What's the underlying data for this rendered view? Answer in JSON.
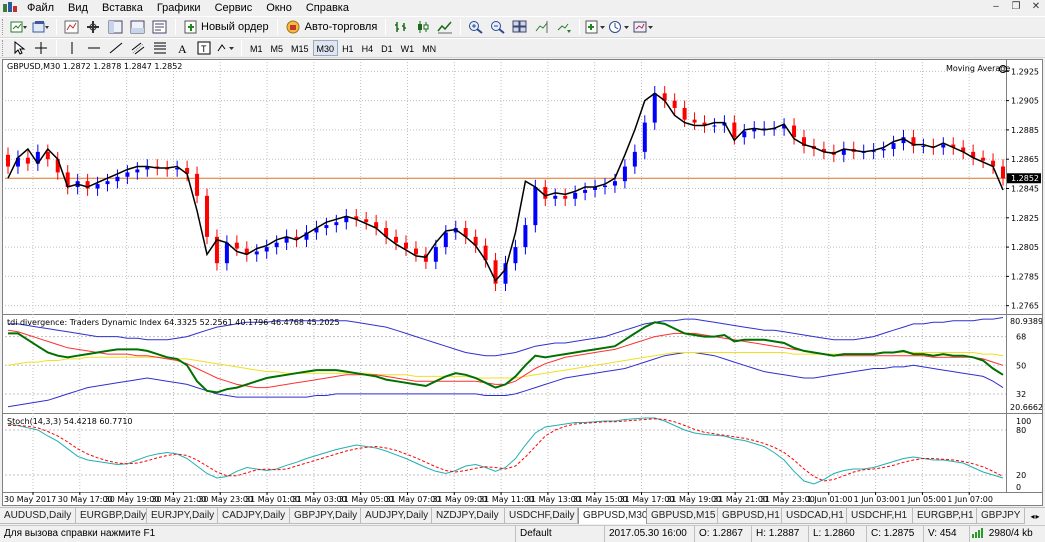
{
  "menu": {
    "items": [
      "Файл",
      "Вид",
      "Вставка",
      "Графики",
      "Сервис",
      "Окно",
      "Справка"
    ]
  },
  "window_controls": [
    "–",
    "❐",
    "✕"
  ],
  "toolbar": {
    "new_order_label": "Новый ордер",
    "autotrading_label": "Авто-торговля",
    "timeframes": [
      "M1",
      "M5",
      "M15",
      "M30",
      "H1",
      "H4",
      "D1",
      "W1",
      "MN"
    ],
    "active_timeframe": "M30"
  },
  "chart": {
    "symbol_header": "GBPUSD,M30  1.2872 1.2878 1.2847 1.2852",
    "indicator_label": "Moving Average",
    "price_ticks": [
      "1.2925",
      "1.2905",
      "1.2885",
      "1.2865",
      "1.2845",
      "1.2825",
      "1.2805",
      "1.2785",
      "1.2765"
    ],
    "price_tick_values": [
      1.2925,
      1.2905,
      1.2885,
      1.2865,
      1.2845,
      1.2825,
      1.2805,
      1.2785,
      1.2765
    ],
    "current_price": "1.2852",
    "current_price_value": 1.2852,
    "tdi_label": "tdi divergence: Traders Dynamic Index 64.3325 52.2561 40.1796 46.4768 45.2025",
    "tdi_ticks": [
      "80.9389",
      "68",
      "50",
      "32",
      "20.6662"
    ],
    "tdi_tick_values": [
      80.9389,
      68,
      50,
      32,
      20.6662
    ],
    "stoch_label": "Stoch(14,3,3) 54.4218 60.7710",
    "stoch_ticks": [
      "100",
      "80",
      "20",
      "0"
    ],
    "stoch_tick_values": [
      100,
      80,
      20,
      0
    ],
    "time_labels": [
      "30 May 2017",
      "30 May 17:00",
      "30 May 19:00",
      "30 May 21:00",
      "30 May 23:00",
      "31 May 01:00",
      "31 May 03:00",
      "31 May 05:00",
      "31 May 07:00",
      "31 May 09:00",
      "31 May 11:00",
      "31 May 13:00",
      "31 May 15:00",
      "31 May 17:00",
      "31 May 19:00",
      "31 May 21:00",
      "31 May 23:00",
      "1 Jun 01:00",
      "1 Jun 03:00",
      "1 Jun 05:00",
      "1 Jun 07:00"
    ],
    "colors": {
      "bull": "#0000ff",
      "bear": "#ff0000",
      "ma": "#000000",
      "price_line": "#e07020",
      "tdi_blue": "#3030d0",
      "tdi_green": "#007000",
      "tdi_red": "#ff3030",
      "tdi_yellow": "#f0e020",
      "stoch_main": "#20b0b0",
      "stoch_signal": "#ff0000",
      "grid": "#c0c0c0"
    }
  },
  "chart_data": {
    "type": "candlestick",
    "price_close": [
      1.286,
      1.2866,
      1.2862,
      1.287,
      1.2865,
      1.2856,
      1.2846,
      1.285,
      1.2845,
      1.2848,
      1.285,
      1.2853,
      1.2856,
      1.2858,
      1.286,
      1.2859,
      1.2858,
      1.2859,
      1.2855,
      1.284,
      1.2812,
      1.2794,
      1.2808,
      1.2804,
      1.28,
      1.2802,
      1.2805,
      1.2808,
      1.2812,
      1.281,
      1.2815,
      1.2818,
      1.282,
      1.2822,
      1.2826,
      1.2824,
      1.2822,
      1.2818,
      1.2812,
      1.2808,
      1.2804,
      1.28,
      1.2795,
      1.2805,
      1.2815,
      1.2818,
      1.2812,
      1.2806,
      1.2796,
      1.278,
      1.2794,
      1.2805,
      1.282,
      1.2846,
      1.2838,
      1.284,
      1.2838,
      1.2842,
      1.2844,
      1.2846,
      1.2847,
      1.285,
      1.286,
      1.287,
      1.289,
      1.291,
      1.2905,
      1.29,
      1.2892,
      1.289,
      1.2888,
      1.2888,
      1.289,
      1.288,
      1.2884,
      1.2886,
      1.2886,
      1.2886,
      1.2888,
      1.288,
      1.2874,
      1.2872,
      1.287,
      1.2868,
      1.2872,
      1.287,
      1.287,
      1.2871,
      1.2872,
      1.2876,
      1.288,
      1.2874,
      1.2874,
      1.2873,
      1.2875,
      1.2873,
      1.287,
      1.2866,
      1.2864,
      1.286,
      1.2852
    ],
    "ma_values": [
      1.2852,
      1.2866,
      1.2872,
      1.2862,
      1.2872,
      1.2865,
      1.2846,
      1.2848,
      1.2846,
      1.2849,
      1.2852,
      1.2855,
      1.2858,
      1.286,
      1.286,
      1.2859,
      1.2859,
      1.286,
      1.2855,
      1.283,
      1.28,
      1.281,
      1.2808,
      1.2802,
      1.28,
      1.2804,
      1.2806,
      1.281,
      1.2812,
      1.281,
      1.2814,
      1.2818,
      1.2822,
      1.2824,
      1.2826,
      1.2824,
      1.2821,
      1.2818,
      1.2812,
      1.2807,
      1.2803,
      1.2799,
      1.2798,
      1.2808,
      1.2816,
      1.2817,
      1.2812,
      1.2806,
      1.2796,
      1.2782,
      1.279,
      1.2815,
      1.285,
      1.2846,
      1.284,
      1.2842,
      1.2841,
      1.2843,
      1.2846,
      1.2846,
      1.2848,
      1.2852,
      1.2868,
      1.2885,
      1.2905,
      1.291,
      1.2905,
      1.2895,
      1.289,
      1.2888,
      1.2888,
      1.289,
      1.289,
      1.2878,
      1.2885,
      1.2886,
      1.2885,
      1.2886,
      1.2889,
      1.2879,
      1.2875,
      1.2873,
      1.287,
      1.2869,
      1.2872,
      1.2871,
      1.287,
      1.2871,
      1.2873,
      1.2877,
      1.2879,
      1.2875,
      1.2875,
      1.2873,
      1.2876,
      1.2873,
      1.287,
      1.2866,
      1.2863,
      1.286,
      1.2844
    ],
    "tdi_upper": [
      76,
      76,
      75,
      74,
      73,
      72,
      71,
      70,
      69,
      68,
      68,
      68,
      67,
      67,
      66,
      66,
      66,
      67,
      68,
      70,
      72,
      74,
      75,
      76,
      77,
      77,
      77,
      78,
      78,
      78,
      78,
      78,
      78,
      78,
      78,
      77,
      76,
      75,
      74,
      72,
      70,
      68,
      66,
      64,
      62,
      60,
      58,
      57,
      56,
      56,
      57,
      58,
      60,
      62,
      63,
      64,
      64,
      65,
      66,
      67,
      68,
      70,
      72,
      74,
      76,
      77,
      78,
      78,
      79,
      79,
      78,
      77,
      76,
      75,
      74,
      73,
      72,
      72,
      71,
      70,
      69,
      68,
      67,
      66,
      66,
      66,
      67,
      68,
      70,
      72,
      74,
      76,
      76,
      77,
      77,
      78,
      78,
      78,
      79,
      79,
      80
    ],
    "tdi_lower": [
      24,
      25,
      26,
      27,
      28,
      30,
      32,
      34,
      36,
      37,
      38,
      39,
      40,
      41,
      42,
      41,
      40,
      39,
      38,
      36,
      34,
      32,
      31,
      30,
      30,
      30,
      30,
      30,
      30,
      30,
      30,
      31,
      31,
      32,
      32,
      32,
      32,
      32,
      32,
      32,
      32,
      32,
      32,
      32,
      32,
      32,
      32,
      32,
      31,
      31,
      31,
      32,
      34,
      36,
      38,
      40,
      42,
      43,
      44,
      45,
      46,
      47,
      48,
      50,
      52,
      54,
      56,
      57,
      58,
      58,
      57,
      56,
      54,
      52,
      50,
      48,
      46,
      45,
      44,
      43,
      42,
      42,
      43,
      44,
      45,
      46,
      47,
      48,
      48,
      49,
      49,
      50,
      49,
      48,
      47,
      46,
      45,
      44,
      43,
      40,
      36
    ],
    "tdi_yellow": [
      50,
      51,
      52,
      52,
      53,
      53,
      54,
      54,
      55,
      55,
      55,
      55,
      55,
      55,
      55,
      55,
      55,
      54,
      54,
      53,
      52,
      51,
      50,
      49,
      48,
      47,
      46,
      46,
      45,
      45,
      45,
      45,
      45,
      45,
      45,
      45,
      45,
      44,
      44,
      44,
      44,
      43,
      43,
      43,
      43,
      43,
      43,
      42,
      42,
      42,
      42,
      42,
      43,
      44,
      45,
      46,
      47,
      48,
      49,
      50,
      51,
      52,
      53,
      54,
      55,
      56,
      57,
      58,
      58,
      58,
      58,
      58,
      58,
      58,
      58,
      58,
      58,
      58,
      58,
      57,
      57,
      57,
      57,
      57,
      57,
      57,
      57,
      57,
      58,
      58,
      58,
      58,
      58,
      58,
      58,
      58,
      58,
      58,
      57,
      57,
      56
    ],
    "tdi_red": [
      72,
      71,
      69,
      67,
      65,
      63,
      61,
      60,
      59,
      58,
      57,
      57,
      57,
      56,
      56,
      55,
      54,
      53,
      51,
      48,
      45,
      42,
      40,
      38,
      37,
      36,
      36,
      37,
      38,
      39,
      40,
      41,
      42,
      43,
      44,
      44,
      44,
      44,
      43,
      42,
      41,
      40,
      40,
      40,
      40,
      40,
      40,
      40,
      39,
      38,
      38,
      40,
      44,
      48,
      51,
      53,
      55,
      56,
      57,
      58,
      59,
      60,
      62,
      64,
      66,
      68,
      69,
      70,
      70,
      70,
      69,
      68,
      67,
      66,
      65,
      64,
      63,
      62,
      61,
      60,
      59,
      58,
      57,
      56,
      56,
      56,
      56,
      56,
      56,
      56,
      56,
      56,
      56,
      55,
      55,
      55,
      55,
      55,
      54,
      52,
      50
    ],
    "tdi_green": [
      70,
      70,
      66,
      62,
      58,
      56,
      55,
      56,
      57,
      58,
      59,
      60,
      60,
      60,
      59,
      57,
      55,
      54,
      50,
      40,
      34,
      33,
      35,
      36,
      38,
      40,
      42,
      43,
      44,
      45,
      46,
      47,
      47,
      47,
      46,
      45,
      44,
      43,
      41,
      40,
      39,
      38,
      37,
      40,
      43,
      45,
      44,
      42,
      39,
      36,
      38,
      43,
      50,
      56,
      55,
      56,
      57,
      58,
      59,
      60,
      61,
      62,
      66,
      70,
      74,
      77,
      76,
      73,
      70,
      69,
      68,
      68,
      69,
      65,
      66,
      66,
      66,
      65,
      64,
      61,
      59,
      58,
      57,
      56,
      57,
      57,
      57,
      57,
      58,
      58,
      59,
      57,
      57,
      56,
      57,
      56,
      56,
      55,
      53,
      48,
      44
    ],
    "stoch_main": [
      88,
      86,
      83,
      80,
      72,
      65,
      55,
      45,
      40,
      38,
      36,
      34,
      35,
      40,
      45,
      48,
      50,
      48,
      42,
      32,
      22,
      16,
      18,
      25,
      30,
      28,
      26,
      28,
      33,
      37,
      42,
      46,
      50,
      54,
      57,
      60,
      58,
      56,
      52,
      47,
      42,
      36,
      30,
      25,
      22,
      26,
      32,
      34,
      30,
      25,
      30,
      42,
      60,
      76,
      84,
      86,
      88,
      90,
      90,
      91,
      92,
      92,
      94,
      95,
      96,
      96,
      92,
      86,
      80,
      76,
      74,
      73,
      72,
      68,
      66,
      62,
      58,
      50,
      40,
      25,
      12,
      8,
      14,
      22,
      26,
      28,
      28,
      30,
      34,
      38,
      42,
      44,
      42,
      40,
      40,
      38,
      36,
      30,
      24,
      20,
      16
    ],
    "stoch_signal": [
      86,
      86,
      85,
      83,
      78,
      72,
      64,
      55,
      48,
      43,
      39,
      36,
      35,
      36,
      39,
      43,
      46,
      48,
      46,
      40,
      32,
      24,
      19,
      19,
      23,
      27,
      28,
      27,
      28,
      32,
      36,
      40,
      44,
      48,
      52,
      55,
      57,
      58,
      56,
      53,
      48,
      43,
      37,
      31,
      26,
      24,
      26,
      29,
      31,
      30,
      28,
      32,
      44,
      58,
      72,
      80,
      85,
      88,
      89,
      90,
      91,
      91,
      92,
      93,
      94,
      95,
      94,
      91,
      86,
      81,
      77,
      75,
      73,
      71,
      69,
      66,
      62,
      57,
      50,
      40,
      28,
      18,
      12,
      14,
      19,
      24,
      27,
      28,
      30,
      33,
      37,
      40,
      42,
      42,
      41,
      40,
      38,
      35,
      31,
      25,
      18
    ]
  },
  "tabs": [
    "AUDUSD,Daily",
    "EURGBP,Daily",
    "EURJPY,Daily",
    "CADJPY,Daily",
    "GBPJPY,Daily",
    "AUDJPY,Daily",
    "NZDJPY,Daily",
    "USDCHF,Daily",
    "GBPUSD,M30",
    "GBPUSD,M15",
    "GBPUSD,H1",
    "USDCAD,H1",
    "USDCHF,H1",
    "EURGBP,H1",
    "GBPJPY"
  ],
  "active_tab": "GBPUSD,M30",
  "status": {
    "help": "Для вызова справки нажмите F1",
    "profile": "Default",
    "datetime": "2017.05.30 16:00",
    "open": "O: 1.2867",
    "high": "H: 1.2887",
    "low": "L: 1.2860",
    "close": "C: 1.2875",
    "volume": "V: 454",
    "traffic": "2980/4 kb"
  }
}
